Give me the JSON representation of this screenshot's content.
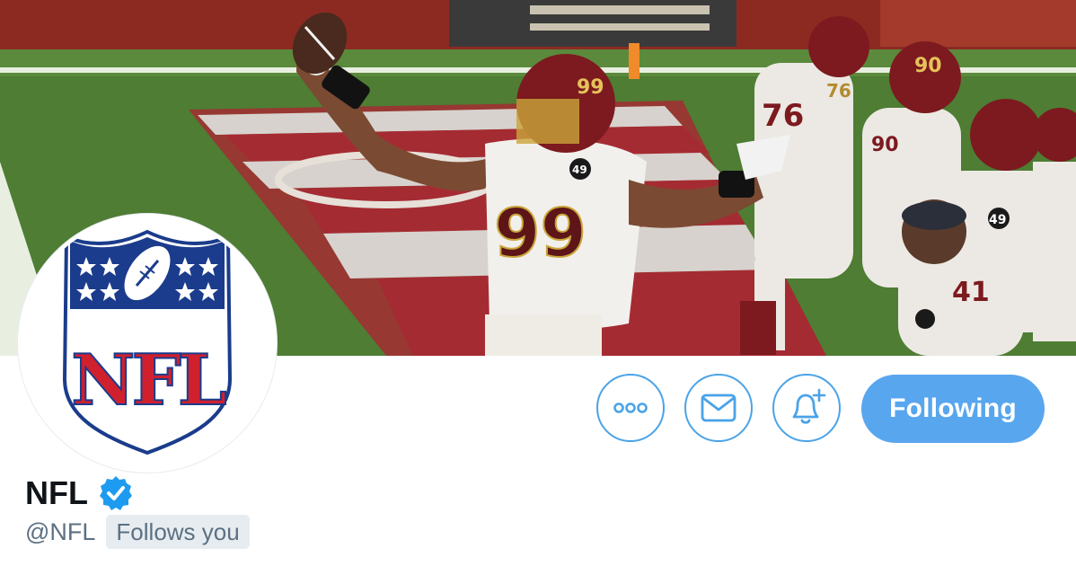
{
  "profile": {
    "display_name": "NFL",
    "handle": "@NFL",
    "follows_you": "Follows you",
    "verified": true
  },
  "actions": {
    "more_icon": "more-horizontal-icon",
    "message_icon": "envelope-icon",
    "notify_icon": "bell-plus-icon",
    "following_label": "Following"
  },
  "banner": {
    "jersey_numbers": [
      "99",
      "76",
      "90",
      "49",
      "41"
    ]
  },
  "avatar": {
    "logo_text": "NFL"
  },
  "colors": {
    "accent": "#4aa3e8",
    "following_button": "#58a6ee",
    "verified_badge": "#1d9bf0",
    "secondary_text": "#5b7083",
    "badge_bg": "#e7ecf0",
    "nfl_blue": "#1b3c8c",
    "nfl_red": "#d0202e"
  }
}
